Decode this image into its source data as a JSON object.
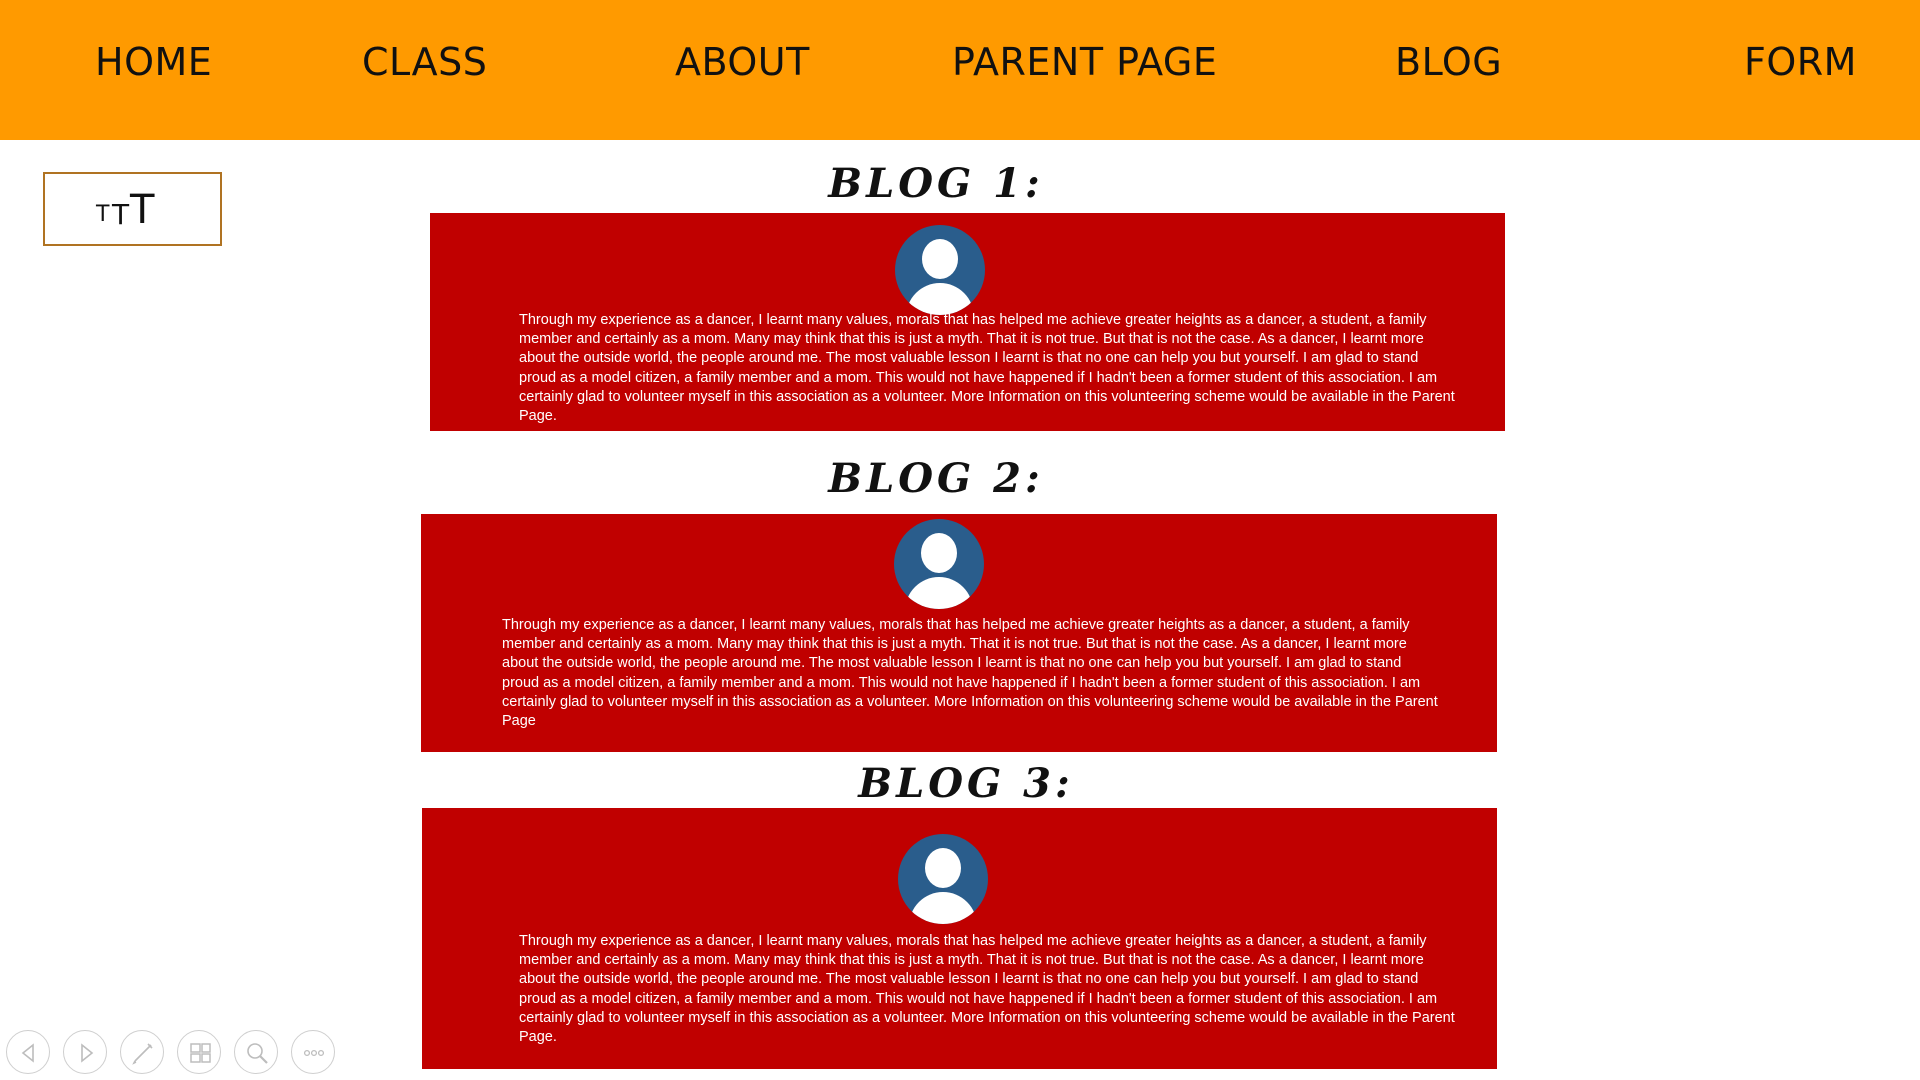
{
  "nav": {
    "home": "HOME",
    "class": "CLASS",
    "about": "ABOUT",
    "parent_page": "PARENT PAGE",
    "blog": "BLOG",
    "form": "FORM"
  },
  "text_size_control": {
    "small": "T",
    "medium": "T",
    "large": "T"
  },
  "blogs": [
    {
      "heading": "BLOG 1:",
      "text": "Through my experience as a dancer, I learnt many values, morals that has helped me achieve greater heights as a dancer, a student, a family member and certainly as a mom. Many may think that this is just a myth. That it is not true. But that is not the case. As a dancer, I learnt more about the outside world, the people around me. The most valuable lesson I learnt is that no one can help you but yourself. I am glad to stand proud as a model citizen, a family member and a mom. This would not have happened if I hadn't been a former student of this association. I am certainly glad to volunteer myself in this association as a volunteer. More Information on this volunteering scheme would be available in the Parent Page."
    },
    {
      "heading": "BLOG 2:",
      "text": "Through my experience as a dancer, I learnt many values, morals that has helped me achieve greater heights as a dancer, a student, a family member and certainly as a mom. Many may think that this is just a myth. That it is not true. But that is not the case. As a dancer, I learnt more about the outside world, the people around me. The most valuable lesson I learnt is that no one can help you but yourself. I am glad to stand proud as a model citizen, a family member and a mom. This would not have happened if I hadn't been a former student of this association. I am certainly glad to volunteer myself in this association as a volunteer. More Information on this volunteering scheme would be available in the Parent Page"
    },
    {
      "heading": "BLOG 3:",
      "text": "Through my experience as a dancer, I learnt many values, morals that has helped me achieve greater heights as a dancer, a student, a family member and certainly as a mom. Many may think that this is just a myth. That it is not true. But that is not the case. As a dancer, I learnt more about the outside world, the people around me. The most valuable lesson I learnt is that no one can help you but yourself. I am glad to stand proud as a model citizen, a family member and a mom. This would not have happened if I hadn't been a former student of this association. I am certainly glad to volunteer myself in this association as a volunteer. More Information on this volunteering scheme would be available in the Parent Page."
    }
  ],
  "controls": [
    "previous-icon",
    "next-icon",
    "pen-icon",
    "slides-icon",
    "zoom-icon",
    "more-icon"
  ],
  "colors": {
    "nav_bg": "#ff9a00",
    "card_bg": "#c00000",
    "avatar_bg": "#2a5d8c",
    "text_size_border": "#b07322"
  }
}
